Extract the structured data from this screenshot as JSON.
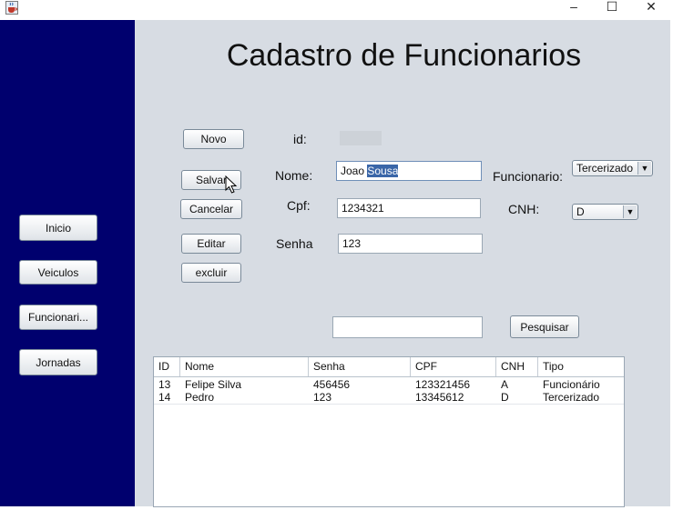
{
  "window": {
    "minimize_glyph": "–",
    "maximize_glyph": "☐",
    "close_glyph": "✕"
  },
  "sidebar": {
    "items": [
      {
        "label": "Inicio"
      },
      {
        "label": "Veiculos"
      },
      {
        "label": "Funcionari..."
      },
      {
        "label": "Jornadas"
      }
    ]
  },
  "page": {
    "title": "Cadastro de Funcionarios"
  },
  "actions": {
    "novo": "Novo",
    "salvar": "Salvar",
    "cancelar": "Cancelar",
    "editar": "Editar",
    "excluir": "excluir",
    "pesquisar": "Pesquisar"
  },
  "form": {
    "id_label": "id:",
    "nome_label": "Nome:",
    "nome_value_plain": "Joao ",
    "nome_value_selected": "Sousa",
    "cpf_label": "Cpf:",
    "cpf_value": "1234321",
    "senha_label": "Senha",
    "senha_value": "123",
    "funcionario_label": "Funcionario:",
    "funcionario_value": "Tercerizado",
    "cnh_label": "CNH:",
    "cnh_value": "D",
    "search_value": ""
  },
  "table": {
    "columns": [
      "ID",
      "Nome",
      "Senha",
      "CPF",
      "CNH",
      "Tipo"
    ],
    "rows": [
      [
        "13",
        "Felipe Silva",
        "456456",
        "123321456",
        "A",
        "Funcionário"
      ],
      [
        "14",
        "Pedro",
        "123",
        "13345612",
        "D",
        "Tercerizado"
      ]
    ]
  },
  "colors": {
    "sidebar_bg": "#00006e",
    "content_bg": "#d7dce3",
    "selection_bg": "#3a66a8"
  },
  "icons": {
    "app": "java-cup-icon",
    "combo_arrow": "▼"
  }
}
